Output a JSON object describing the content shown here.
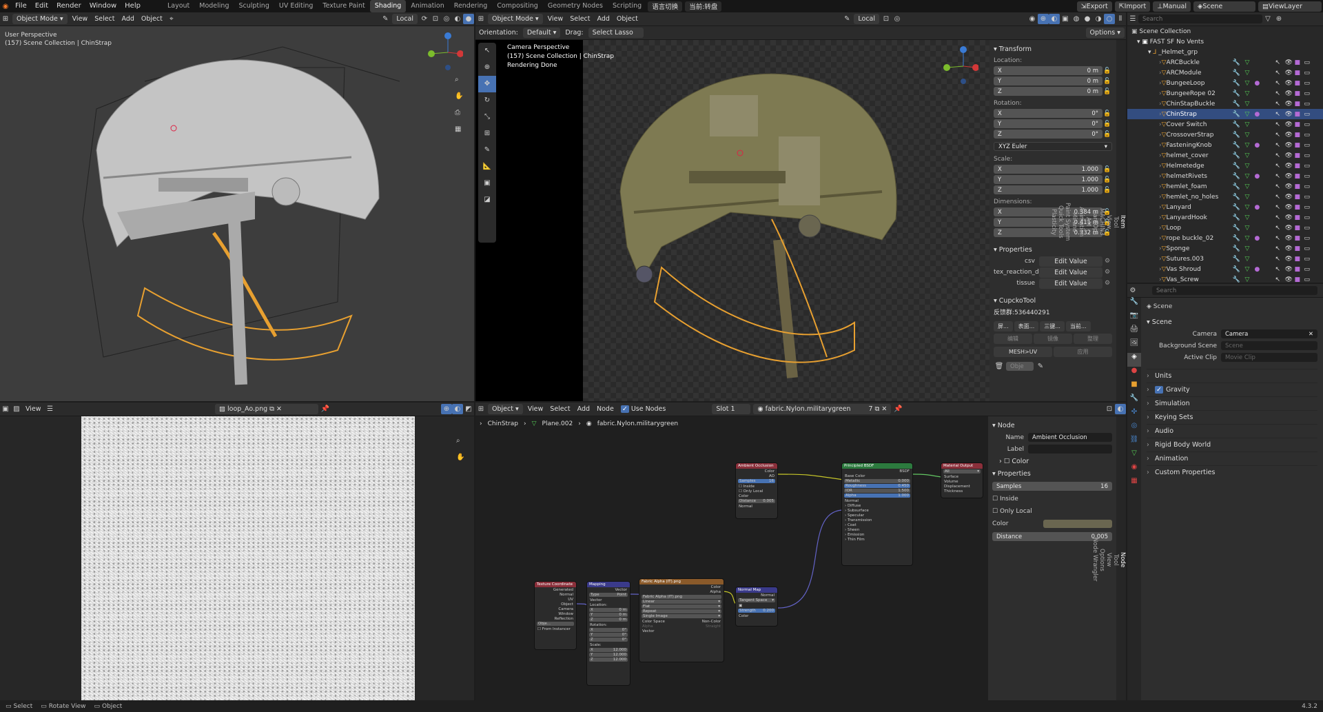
{
  "topbar": {
    "menus": [
      "File",
      "Edit",
      "Render",
      "Window",
      "Help"
    ],
    "workspaces": [
      "Layout",
      "Modeling",
      "Sculpting",
      "UV Editing",
      "Texture Paint",
      "Shading",
      "Animation",
      "Rendering",
      "Compositing",
      "Geometry Nodes",
      "Scripting"
    ],
    "active_ws": "Shading",
    "lang1": "语言切换",
    "lang2": "当前:转盘",
    "export": "Export",
    "import": "Import",
    "manual": "Manual",
    "scene": "Scene",
    "viewlayer": "ViewLayer"
  },
  "vp1": {
    "mode": "Object Mode",
    "view": "View",
    "select": "Select",
    "add": "Add",
    "object": "Object",
    "orient": "Local",
    "title": "User Perspective",
    "subtitle": "(157) Scene Collection | ChinStrap"
  },
  "vp2": {
    "mode": "Object Mode",
    "view": "View",
    "select": "Select",
    "add": "Add",
    "object": "Object",
    "orient": "Local",
    "orientation_label": "Orientation:",
    "orientation": "Default",
    "drag_label": "Drag:",
    "drag": "Select Lasso",
    "options": "Options",
    "title": "Camera Perspective",
    "subtitle": "(157) Scene Collection | ChinStrap",
    "status": "Rendering Done"
  },
  "npanel": {
    "tabs": [
      "Item",
      "Tool",
      "View",
      "MACHIN3",
      "HardOps",
      "AM",
      "Animation",
      "Mirano",
      "Paint System",
      "Quick Tools",
      "Plasticity"
    ],
    "transform": "Transform",
    "location": "Location:",
    "rotation": "Rotation:",
    "scale": "Scale:",
    "dimensions": "Dimensions:",
    "euler": "XYZ Euler",
    "loc": [
      [
        "X",
        "0 m"
      ],
      [
        "Y",
        "0 m"
      ],
      [
        "Z",
        "0 m"
      ]
    ],
    "rot": [
      [
        "X",
        "0°"
      ],
      [
        "Y",
        "0°"
      ],
      [
        "Z",
        "0°"
      ]
    ],
    "scl": [
      [
        "X",
        "1.000"
      ],
      [
        "Y",
        "1.000"
      ],
      [
        "Z",
        "1.000"
      ]
    ],
    "dim": [
      [
        "X",
        "0.384 m"
      ],
      [
        "Y",
        "0.411 m"
      ],
      [
        "Z",
        "0.332 m"
      ]
    ],
    "properties": "Properties",
    "props": [
      [
        "csv",
        "Edit Value"
      ],
      [
        "tex_reaction_d...",
        "Edit Value"
      ],
      [
        "tissue",
        "Edit Value"
      ]
    ],
    "cupcko": "CupckoTool",
    "qq": "反馈群:536440291",
    "cb1": "屏...",
    "cb2": "表面...",
    "cb3": "三键...",
    "cb4": "当前...",
    "cb5": "编辑",
    "cb6": "镜像",
    "cb7": "整理",
    "meshuv": "MESH>UV",
    "apply": "应用",
    "objfield": "Obje"
  },
  "outliner": {
    "search": "Search",
    "root": "Scene Collection",
    "coll": "FAST SF No Vents",
    "group": "_Helmet_grp",
    "items": [
      "ARCBuckle",
      "ARCModule",
      "BungeeLoop",
      "BungeeRope 02",
      "ChinStapBuckle",
      "ChinStrap",
      "Cover Switch",
      "CrossoverStrap",
      "FasteningKnob",
      "helmet_cover",
      "Helmetedge",
      "helmetRivets",
      "hemlet_foam",
      "hemlet_no_holes",
      "Lanyard",
      "LanyardHook",
      "Loop",
      "rope buckle_02",
      "Sponge",
      "Sutures.003",
      "Vas Shroud",
      "Vas_Screw"
    ],
    "selected": "ChinStrap"
  },
  "props_editor": {
    "search": "Search",
    "title": "Scene",
    "scene_sec": "Scene",
    "camera_label": "Camera",
    "camera": "Camera",
    "bg_label": "Background Scene",
    "bg_ph": "Scene",
    "clip_label": "Active Clip",
    "clip_ph": "Movie Clip",
    "sections": [
      "Units",
      "Gravity",
      "Simulation",
      "Keying Sets",
      "Audio",
      "Rigid Body World",
      "Animation",
      "Custom Properties"
    ]
  },
  "image_editor": {
    "view": "View",
    "image": "loop_Ao.png"
  },
  "node_editor": {
    "object": "Object",
    "view": "View",
    "select": "Select",
    "add": "Add",
    "node": "Node",
    "use_nodes": "Use Nodes",
    "slot": "Slot 1",
    "material": "fabric.Nylon.militarygreen",
    "users": "7",
    "bc1": "ChinStrap",
    "bc2": "Plane.002",
    "bc3": "fabric.Nylon.militarygreen",
    "tabs": [
      "Node",
      "Tool",
      "View",
      "Options",
      "Node Wrangler"
    ],
    "panel": {
      "node": "Node",
      "name_label": "Name",
      "name": "Ambient Occlusion",
      "label_label": "Label",
      "color": "Color",
      "properties": "Properties",
      "samples_label": "Samples",
      "samples": "16",
      "inside": "Inside",
      "only_local": "Only Local",
      "color2": "Color",
      "distance_label": "Distance",
      "distance": "0.005",
      "color_swatch": "#6a6650"
    }
  },
  "nodes": {
    "ao": "Ambient Occlusion",
    "bsdf": "Principled BSDF",
    "out": "Material Output",
    "texcoord": "Texture Coordinate",
    "mapping": "Mapping",
    "image": "Fabric Alpha (IT).png",
    "normal": "Normal Map"
  },
  "status": {
    "select": "Select",
    "rotate": "Rotate View",
    "object": "Object",
    "version": "4.3.2"
  },
  "colors": {
    "accent": "#4772b3",
    "orange": "#e8a030",
    "bg": "#303030"
  }
}
